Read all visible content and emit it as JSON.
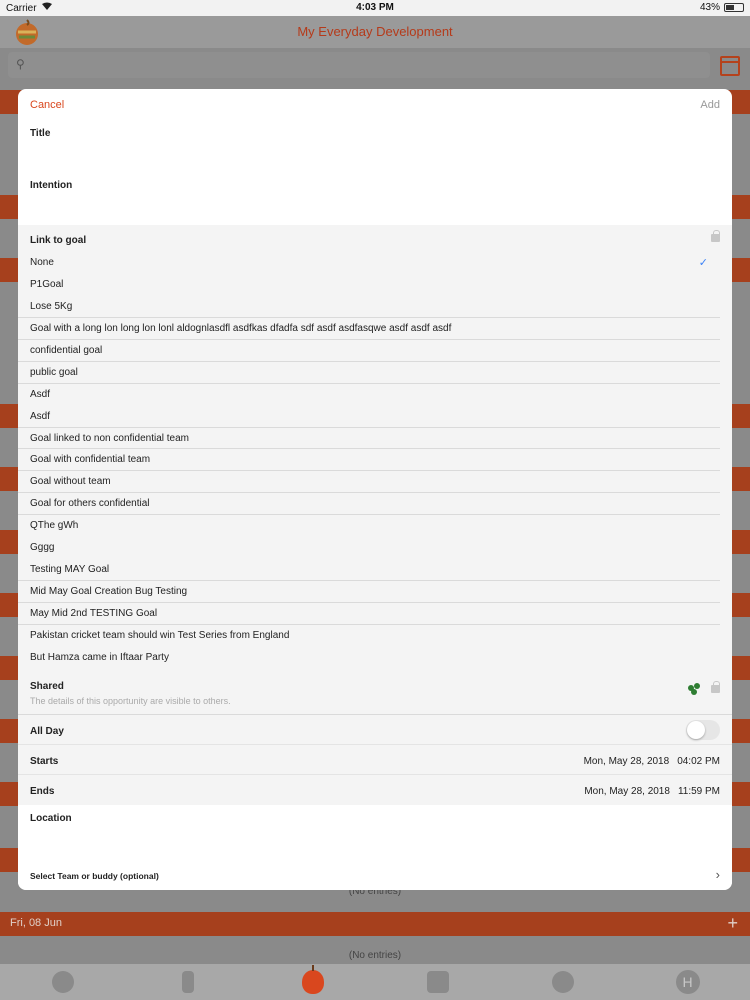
{
  "status_bar": {
    "carrier": "Carrier",
    "time": "4:03 PM",
    "battery": "43%",
    "battery_level": 0.43
  },
  "app": {
    "title": "My Everyday Development"
  },
  "background": {
    "strip_label": "Fri, 08 Jun",
    "no_entries": "(No entries)"
  },
  "modal": {
    "cancel_label": "Cancel",
    "add_label": "Add",
    "title_label": "Title",
    "intention_label": "Intention",
    "link_to_goal_label": "Link to goal",
    "goals": [
      "None",
      "P1Goal",
      "Lose 5Kg",
      "Goal with a long lon long lon lonl aldognlasdfl asdfkas dfadfa sdf asdf asdfasqwe asdf asdf asdf",
      "confidential goal",
      "public goal",
      "Asdf",
      "Asdf",
      "Goal linked to non confidential team",
      "Goal with confidential team",
      "Goal without team",
      "Goal for others confidential",
      "QThe gWh",
      "Gggg",
      "Testing MAY Goal",
      "Mid May Goal Creation Bug Testing",
      "May Mid 2nd TESTING Goal",
      "Pakistan cricket team should win Test Series from England",
      "But Hamza came in Iftaar Party"
    ],
    "selected_goal": "None",
    "shared_label": "Shared",
    "shared_desc": "The details of this opportunity are visible to others.",
    "all_day_label": "All Day",
    "all_day_on": false,
    "starts_label": "Starts",
    "starts_date": "Mon, May 28, 2018",
    "starts_time": "04:02 PM",
    "ends_label": "Ends",
    "ends_date": "Mon, May 28, 2018",
    "ends_time": "11:59 PM",
    "location_label": "Location",
    "team_label": "Select Team or buddy (optional)"
  },
  "colors": {
    "accent": "#d9471e",
    "check": "#3b82f6",
    "shared_icon": "#2e7d32"
  }
}
